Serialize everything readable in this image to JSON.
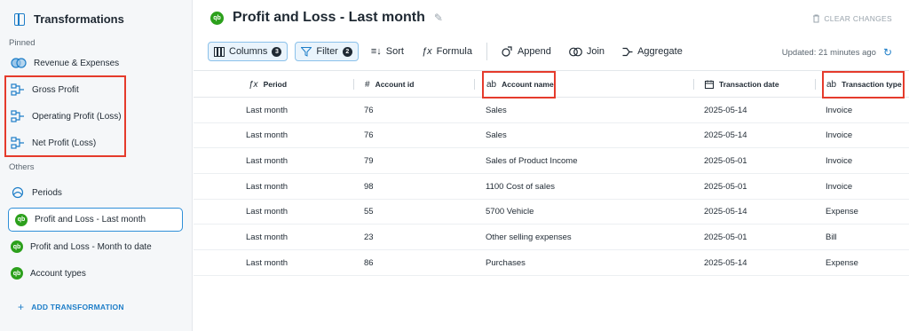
{
  "sidebar": {
    "title": "Transformations",
    "pinned_label": "Pinned",
    "pinned": [
      {
        "label": "Revenue & Expenses",
        "icon": "overlap-circles-icon"
      },
      {
        "label": "Gross Profit",
        "icon": "flow-icon"
      },
      {
        "label": "Operating Profit (Loss)",
        "icon": "flow-icon"
      },
      {
        "label": "Net Profit (Loss)",
        "icon": "flow-icon"
      }
    ],
    "others_label": "Others",
    "others": [
      {
        "label": "Periods",
        "icon": "periods-icon"
      },
      {
        "label": "Profit and Loss - Last month",
        "icon": "quickbooks-icon",
        "active": true
      },
      {
        "label": "Profit and Loss - Month to date",
        "icon": "quickbooks-icon"
      },
      {
        "label": "Account types",
        "icon": "quickbooks-icon"
      }
    ],
    "add_label": "ADD TRANSFORMATION"
  },
  "header": {
    "title": "Profit and Loss - Last month",
    "logo_text": "qb",
    "clear_changes": "CLEAR CHANGES"
  },
  "toolbar": {
    "columns_label": "Columns",
    "columns_count": "3",
    "filter_label": "Filter",
    "filter_count": "2",
    "sort_label": "Sort",
    "formula_label": "Formula",
    "append_label": "Append",
    "join_label": "Join",
    "aggregate_label": "Aggregate",
    "updated": "Updated: 21 minutes ago"
  },
  "table": {
    "columns": [
      {
        "label": "Period",
        "icon": "fx"
      },
      {
        "label": "Account id",
        "icon": "#"
      },
      {
        "label": "Account name",
        "icon": "ab"
      },
      {
        "label": "Transaction date",
        "icon": "calendar"
      },
      {
        "label": "Transaction type",
        "icon": "ab"
      }
    ],
    "rows": [
      [
        "Last month",
        "76",
        "Sales",
        "2025-05-14",
        "Invoice"
      ],
      [
        "Last month",
        "76",
        "Sales",
        "2025-05-14",
        "Invoice"
      ],
      [
        "Last month",
        "79",
        "Sales of Product Income",
        "2025-05-01",
        "Invoice"
      ],
      [
        "Last month",
        "98",
        "1100 Cost of sales",
        "2025-05-01",
        "Invoice"
      ],
      [
        "Last month",
        "55",
        "5700 Vehicle",
        "2025-05-14",
        "Expense"
      ],
      [
        "Last month",
        "23",
        "Other selling expenses",
        "2025-05-01",
        "Bill"
      ],
      [
        "Last month",
        "86",
        "Purchases",
        "2025-05-14",
        "Expense"
      ]
    ]
  },
  "colors": {
    "accent": "#1e7ec8",
    "quickbooks_green": "#2ca01c",
    "highlight_red": "#e53b2c"
  }
}
